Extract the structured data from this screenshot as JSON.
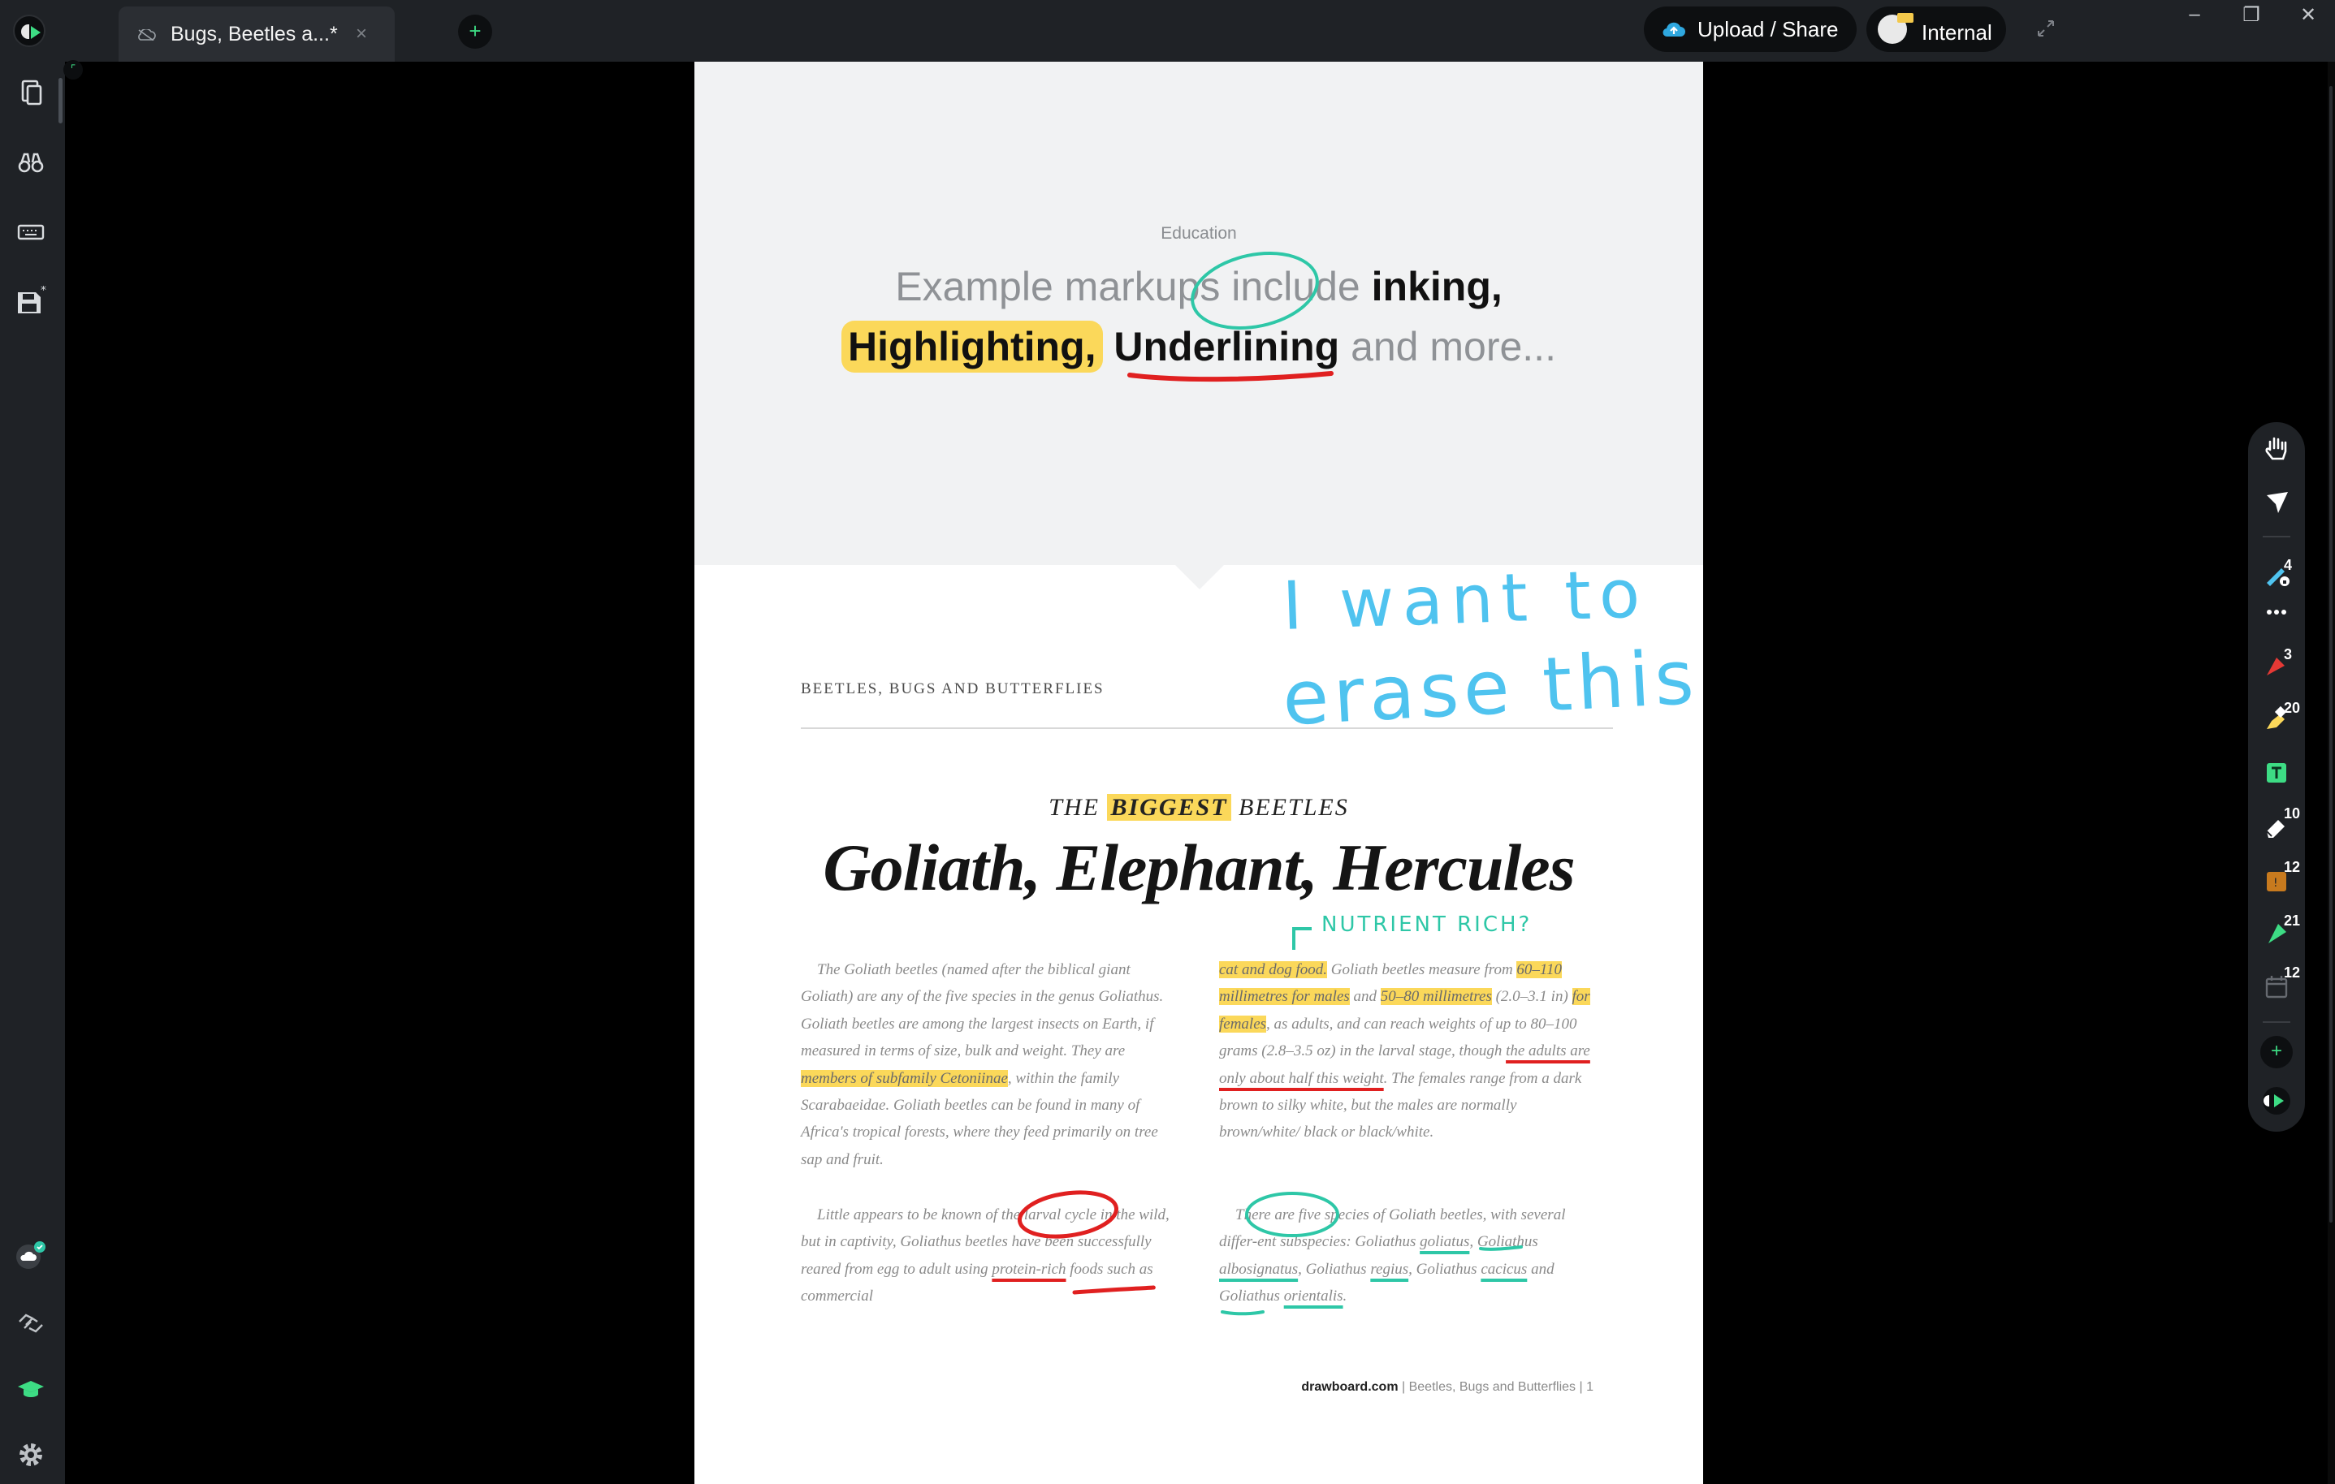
{
  "titlebar": {
    "tab_title": "Bugs, Beetles a...*",
    "tab_close": "×",
    "new_tab": "+",
    "upload_label": "Upload / Share",
    "account_label": "Internal",
    "minimize": "–",
    "maximize": "❐",
    "close": "✕"
  },
  "sidebar": {
    "items": [
      {
        "name": "documents-icon"
      },
      {
        "name": "binoculars-icon"
      },
      {
        "name": "keyboard-icon"
      },
      {
        "name": "save-icon",
        "modified_marker": "*"
      }
    ],
    "bottom_items": [
      {
        "name": "cloud-sync-icon"
      },
      {
        "name": "handshake-icon"
      },
      {
        "name": "education-icon"
      },
      {
        "name": "settings-icon"
      }
    ]
  },
  "toolbar": {
    "tools": [
      {
        "name": "hand-tool-icon"
      },
      {
        "name": "select-tool-icon"
      },
      {
        "name": "pen-tool-icon",
        "count": "4",
        "color": "#4fc3ef"
      },
      {
        "name": "more-options-icon"
      },
      {
        "name": "marker-tool-icon",
        "count": "3",
        "color": "#e53935"
      },
      {
        "name": "highlighter-tool-icon",
        "count": "20",
        "color": "#fbd85a"
      },
      {
        "name": "text-tool-icon",
        "color": "#3ddc84"
      },
      {
        "name": "eraser-tool-icon",
        "count": "10"
      },
      {
        "name": "stamp-tool-icon",
        "count": "12",
        "color": "#c77a1e"
      },
      {
        "name": "shape-tool-icon",
        "count": "21",
        "color": "#3ddc84"
      },
      {
        "name": "calendar-tool-icon",
        "count": "12"
      },
      {
        "name": "add-tool-icon",
        "label": "+"
      },
      {
        "name": "drawboard-icon"
      }
    ]
  },
  "document": {
    "section_label": "Education",
    "headline_line1_prefix": "Example markups include ",
    "headline_inking": "inking,",
    "headline_highlighting": "Highlighting,",
    "headline_underlining": "Underlining",
    "headline_suffix": " and more...",
    "magazine_label": "BEETLES, BUGS AND BUTTERFLIES",
    "kicker_the": "THE ",
    "kicker_biggest": "BIGGEST",
    "kicker_beetles": " BEETLES",
    "title": "Goliath, Elephant, Hercules",
    "left_p1_a": "The Goliath beetles (named after the biblical giant Goliath) are any of the five species in the genus Goliathus. Goliath beetles are among the largest insects on Earth, if measured in terms of size, bulk and weight. They are ",
    "left_p1_mark": "members of subfamily Cetoniinae",
    "left_p1_b": ", within the family Scarabaeidae. Goliath beetles can be found in many of Africa's tropical forests, where they feed primarily on tree sap and fruit.",
    "left_p2_a": "Little appears to be known of the larval cycle in the wild, but in captivity, Goliathus beetles have been successfully reared from egg to adult using ",
    "left_p2_ul": "protein-rich",
    "left_p2_b": " foods such as commercial",
    "right_p1_mark1": "cat and dog food.",
    "right_p1_a": " Goliath beetles measure from ",
    "right_p1_mark2": "60–110 millimetres for males",
    "right_p1_b": " and ",
    "right_p1_mark3": "50–80 millimetres",
    "right_p1_c": " (2.0–3.1 in) ",
    "right_p1_mark4": "for females",
    "right_p1_d": ", as adults, and can reach weights of up to 80–100 grams (2.8–3.5 oz) in the larval stage, though ",
    "right_p1_ul": "the adults are only about half this weight",
    "right_p1_e": ". The females range from a dark brown to silky white, but the males are normally brown/white/ black or black/white.",
    "right_p2_a": "There are five species of Goliath beetles, with several differ-ent subspecies: Goliathus ",
    "right_p2_ul1": "goliatus",
    "right_p2_b": ", Goliathus ",
    "right_p2_ul2": "albosignatus",
    "right_p2_c": ", Goliathus ",
    "right_p2_ul3": "regius",
    "right_p2_d": ", Goliathus ",
    "right_p2_ul4": "cacicus",
    "right_p2_e": " and Goliathus ",
    "right_p2_ul5": "orientalis",
    "right_p2_f": ".",
    "footer_site": "drawboard.com",
    "footer_sep": "  |  ",
    "footer_title": "Beetles, Bugs and Butterflies",
    "footer_page": "1"
  },
  "annotations": {
    "handwriting_line1": "I want to",
    "handwriting_line2": "erase this",
    "margin_note": "NUTRIENT RICH?",
    "ink_blue": "#4fc3ef",
    "ink_red": "#e02020",
    "ink_teal": "#2ec7a7",
    "highlight_yellow": "#fbd85a"
  }
}
